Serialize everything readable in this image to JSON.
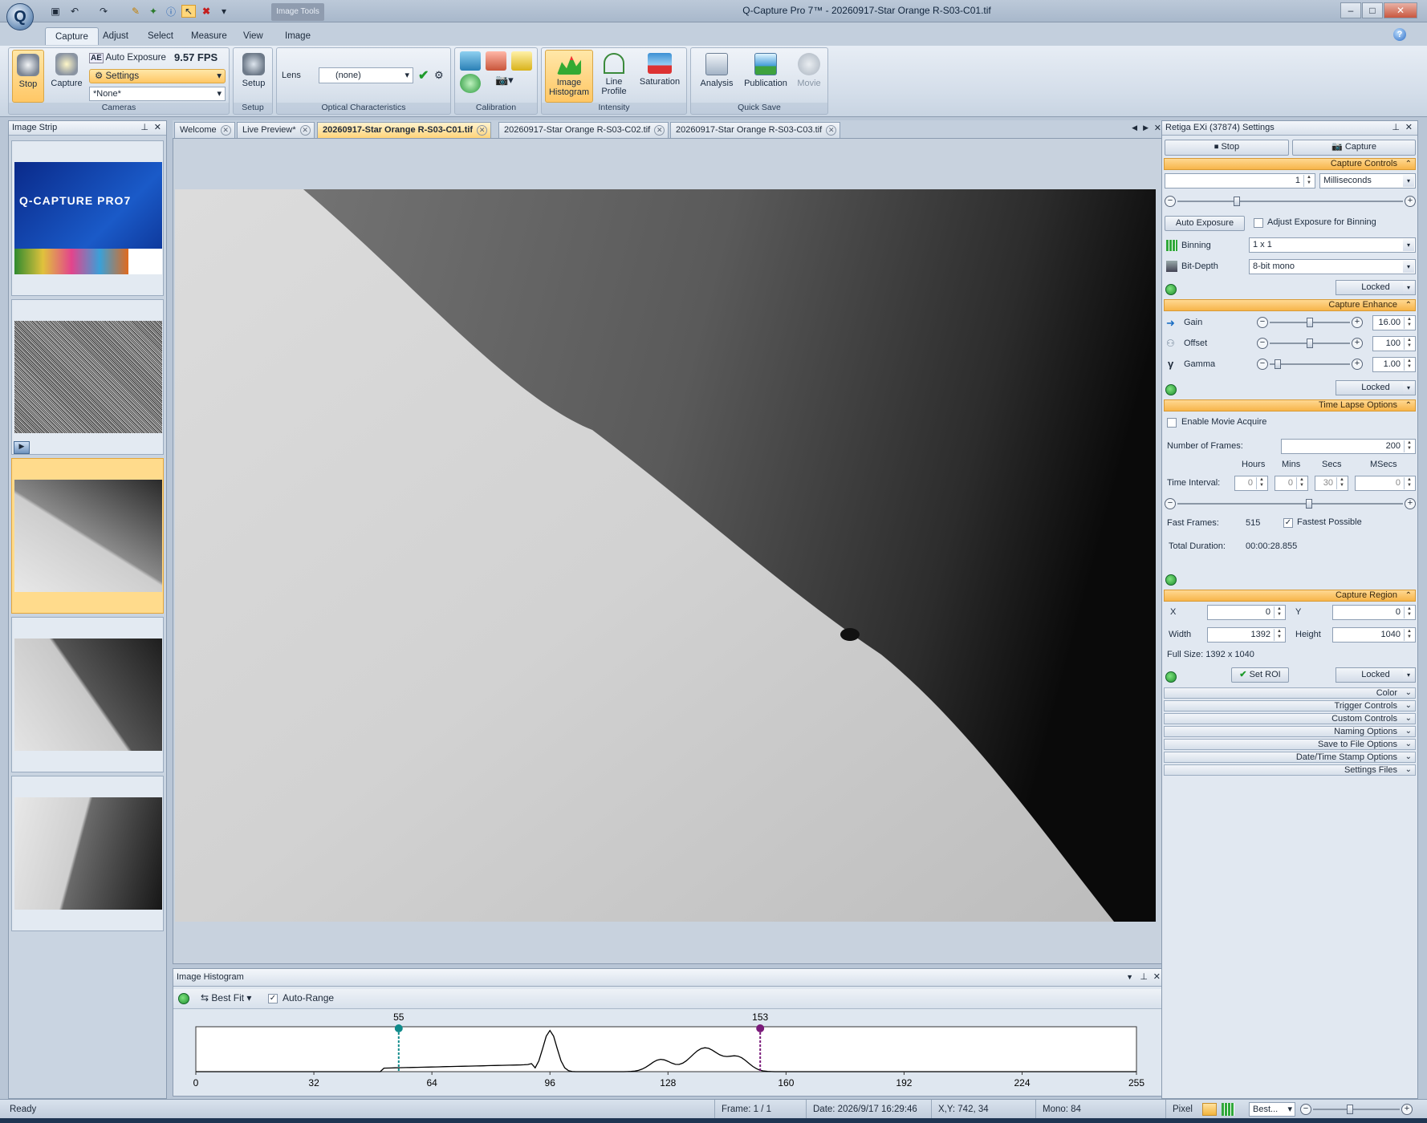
{
  "window": {
    "title": "Q-Capture Pro 7™ - 20260917-Star Orange R-S03-C01.tif",
    "contextual_tab": "Image Tools"
  },
  "ribbon_tabs": [
    "Capture",
    "Adjust",
    "Select",
    "Measure",
    "View",
    "Image"
  ],
  "ribbon": {
    "stop": "Stop",
    "capture": "Capture",
    "auto_exposure": "Auto Exposure",
    "fps": "9.57 FPS",
    "settings": "Settings",
    "none_preset": "*None*",
    "cameras_group": "Cameras",
    "setup": "Setup",
    "setup_group": "Setup",
    "lens_label": "Lens",
    "lens_value": "(none)",
    "optical_group": "Optical Characteristics",
    "calibration_group": "Calibration",
    "image_histogram": "Image Histogram",
    "line_profile": "Line Profile",
    "saturation": "Saturation",
    "intensity_group": "Intensity",
    "analysis": "Analysis",
    "publication": "Publication",
    "movie": "Movie",
    "quicksave_group": "Quick Save"
  },
  "image_strip": {
    "title": "Image Strip",
    "splash_title": "Q-CAPTURE PRO7"
  },
  "doc_tabs": [
    "Welcome",
    "Live Preview*",
    "20260917-Star Orange R-S03-C01.tif",
    "20260917-Star Orange R-S03-C02.tif",
    "20260917-Star Orange R-S03-C03.tif"
  ],
  "histogram": {
    "title": "Image Histogram",
    "fit": "Best Fit",
    "auto_range": "Auto-Range",
    "low_marker": "55",
    "high_marker": "153",
    "ticks": [
      "0",
      "32",
      "64",
      "96",
      "128",
      "160",
      "192",
      "224",
      "255"
    ],
    "low_value": 55,
    "high_value": 153
  },
  "settings": {
    "title": "Retiga EXi (37874) Settings",
    "stop": "Stop",
    "capture": "Capture",
    "capture_controls": "Capture Controls",
    "exposure_value": "1",
    "exposure_unit": "Milliseconds",
    "auto_exposure": "Auto Exposure",
    "adjust_binning": "Adjust Exposure for Binning",
    "binning_label": "Binning",
    "binning_value": "1 x 1",
    "bitdepth_label": "Bit-Depth",
    "bitdepth_value": "8-bit mono",
    "locked": "Locked",
    "capture_enhance": "Capture Enhance",
    "gain_label": "Gain",
    "gain_value": "16.00",
    "offset_label": "Offset",
    "offset_value": "100",
    "gamma_label": "Gamma",
    "gamma_value": "1.00",
    "time_lapse": "Time Lapse Options",
    "enable_movie": "Enable Movie Acquire",
    "num_frames_label": "Number of  Frames:",
    "num_frames": "200",
    "hours": "Hours",
    "mins": "Mins",
    "secs": "Secs",
    "msecs": "MSecs",
    "time_interval": "Time Interval:",
    "h_val": "0",
    "m_val": "0",
    "s_val": "30",
    "ms_val": "0",
    "fast_frames_label": "Fast Frames:",
    "fast_frames": "515",
    "fastest_possible": "Fastest Possible",
    "total_duration_label": "Total Duration:",
    "total_duration": "00:00:28.855",
    "capture_region": "Capture Region",
    "x_label": "X",
    "x_val": "0",
    "y_label": "Y",
    "y_val": "0",
    "width_label": "Width",
    "width_val": "1392",
    "height_label": "Height",
    "height_val": "1040",
    "full_size": "Full Size: 1392 x 1040",
    "set_roi": "Set ROI",
    "collapsed": [
      "Color",
      "Trigger Controls",
      "Custom Controls",
      "Naming Options",
      "Save to File Options",
      "Date/Time Stamp Options",
      "Settings Files"
    ]
  },
  "status": {
    "ready": "Ready",
    "frame": "Frame: 1 / 1",
    "date": "Date: 2026/9/17 16:29:46",
    "xy": "X,Y:  742,   34",
    "mono": "Mono:   84",
    "pixel": "Pixel",
    "zoom": "Best..."
  }
}
